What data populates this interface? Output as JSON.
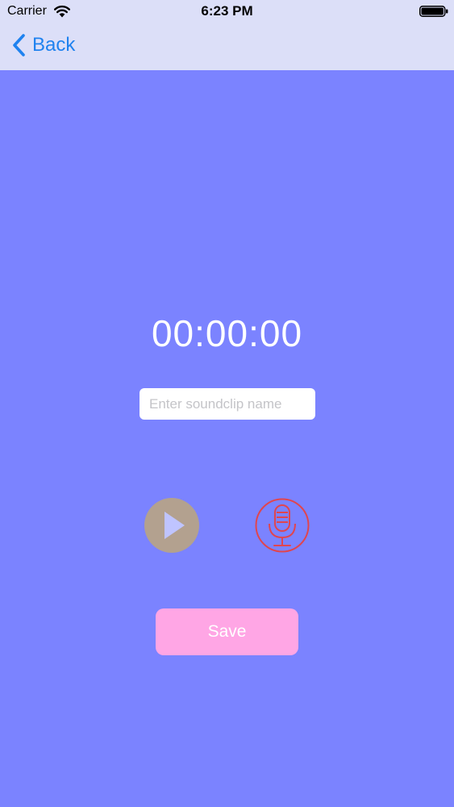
{
  "status_bar": {
    "carrier": "Carrier",
    "time": "6:23 PM",
    "wifi_icon": "wifi-icon",
    "battery_icon": "battery-icon"
  },
  "nav": {
    "back_label": "Back",
    "back_icon": "chevron-left-icon"
  },
  "recorder": {
    "timer": "00:00:00",
    "name_input": {
      "placeholder": "Enter soundclip name",
      "value": ""
    },
    "play_icon": "play-icon",
    "mic_icon": "microphone-icon",
    "save_label": "Save"
  },
  "colors": {
    "background": "#7b83ff",
    "nav_background": "#dcdff8",
    "accent_blue": "#1f82ef",
    "play_button": "#b3a18f",
    "mic_stroke": "#e0454f",
    "save_button": "#ffa6e5"
  }
}
